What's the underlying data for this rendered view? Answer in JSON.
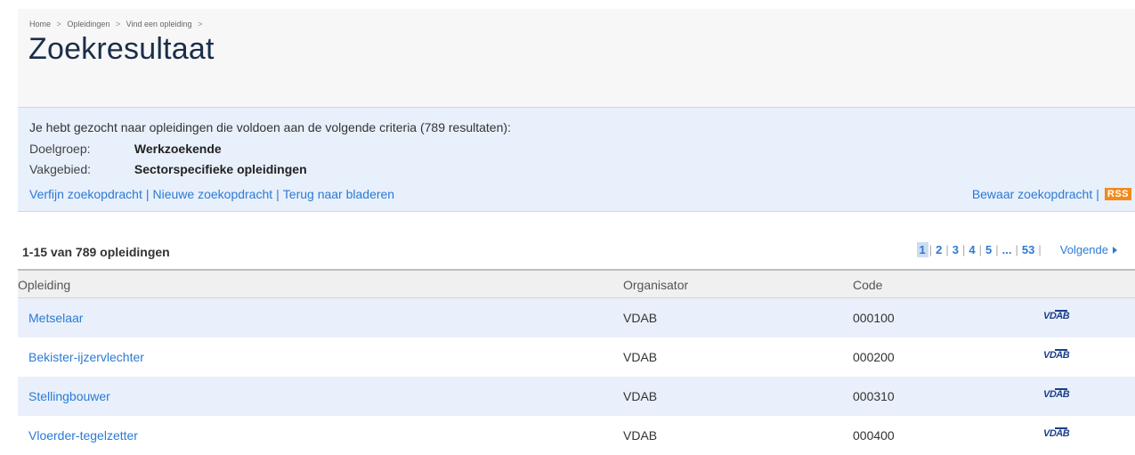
{
  "breadcrumb": [
    {
      "label": "Home"
    },
    {
      "label": "Opleidingen"
    },
    {
      "label": "Vind een opleiding"
    }
  ],
  "breadcrumb_separator": ">",
  "page_title": "Zoekresultaat",
  "criteria": {
    "intro": "Je hebt gezocht naar opleidingen die voldoen aan de volgende criteria (789 resultaten):",
    "rows": [
      {
        "key": "Doelgroep:",
        "value": "Werkzoekende"
      },
      {
        "key": "Vakgebied:",
        "value": "Sectorspecifieke opleidingen"
      }
    ],
    "actions": [
      "Verfijn zoekopdracht",
      "Nieuwe zoekopdracht",
      "Terug naar bladeren"
    ],
    "save_label": "Bewaar zoekopdracht",
    "rss_label": "RSS"
  },
  "results": {
    "summary": "1-15 van 789 opleidingen",
    "pages": [
      "1",
      "2",
      "3",
      "4",
      "5",
      "...",
      "53"
    ],
    "current_page": "1",
    "next_label": "Volgende"
  },
  "table": {
    "headers": {
      "name": "Opleiding",
      "organizer": "Organisator",
      "code": "Code"
    },
    "rows": [
      {
        "name": "Metselaar",
        "organizer": "VDAB",
        "code": "000100",
        "logo": "VDAB"
      },
      {
        "name": "Bekister-ijzervlechter",
        "organizer": "VDAB",
        "code": "000200",
        "logo": "VDAB"
      },
      {
        "name": "Stellingbouwer",
        "organizer": "VDAB",
        "code": "000310",
        "logo": "VDAB"
      },
      {
        "name": "Vloerder-tegelzetter",
        "organizer": "VDAB",
        "code": "000400",
        "logo": "VDAB"
      }
    ]
  },
  "colors": {
    "link": "#2b7ad6",
    "title": "#1a2e4a",
    "criteria_bg": "#e8f0fb",
    "rss": "#f28a1e",
    "logo": "#1c3f8c"
  }
}
